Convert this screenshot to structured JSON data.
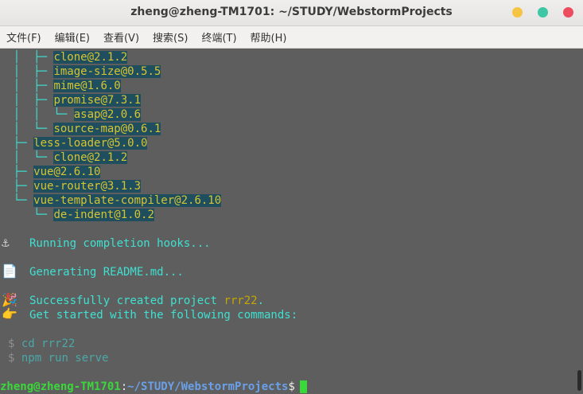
{
  "window": {
    "title": "zheng@zheng-TM1701: ~/STUDY/WebstormProjects"
  },
  "menu": [
    "文件(F)",
    "编辑(E)",
    "查看(V)",
    "搜索(S)",
    "终端(T)",
    "帮助(H)"
  ],
  "terminal": {
    "tree": [
      {
        "prefix": "  │  ├─ ",
        "pkg": "clone@2.1.2"
      },
      {
        "prefix": "  │  ├─ ",
        "pkg": "image-size@0.5.5"
      },
      {
        "prefix": "  │  ├─ ",
        "pkg": "mime@1.6.0"
      },
      {
        "prefix": "  │  ├─ ",
        "pkg": "promise@7.3.1"
      },
      {
        "prefix": "  │  │  └─ ",
        "pkg": "asap@2.0.6"
      },
      {
        "prefix": "  │  └─ ",
        "pkg": "source-map@0.6.1"
      },
      {
        "prefix": "  ├─ ",
        "pkg": "less-loader@5.0.0"
      },
      {
        "prefix": "  │  └─ ",
        "pkg": "clone@2.1.2"
      },
      {
        "prefix": "  ├─ ",
        "pkg": "vue@2.6.10"
      },
      {
        "prefix": "  ├─ ",
        "pkg": "vue-router@3.1.3"
      },
      {
        "prefix": "  └─ ",
        "pkg": "vue-template-compiler@2.6.10"
      },
      {
        "prefix": "     └─ ",
        "pkg": "de-indent@1.0.2"
      }
    ],
    "hooks_msg": "Running completion hooks...",
    "readme_msg": "Generating README.md...",
    "success_prefix": "Successfully created project ",
    "project_name": "rrr22",
    "success_suffix": ".",
    "get_started": "Get started with the following commands:",
    "prompt_symbol": "$",
    "cmd1": "cd rrr22",
    "cmd2": "npm run serve",
    "ps1_user": "zheng@zheng-TM1701",
    "ps1_colon": ":",
    "ps1_path": "~/STUDY/WebstormProjects",
    "ps1_dollar": "$"
  },
  "icons": {
    "anchor": "anchor-icon",
    "document": "document-icon",
    "party": "party-popper-icon",
    "pointer": "pointing-hand-icon"
  },
  "colors": {
    "background": "#5e5e5e",
    "cyan": "#3fe0d0",
    "package": "#d7c432",
    "prompt_user": "#3ad83a",
    "prompt_path": "#6aa0e8"
  }
}
